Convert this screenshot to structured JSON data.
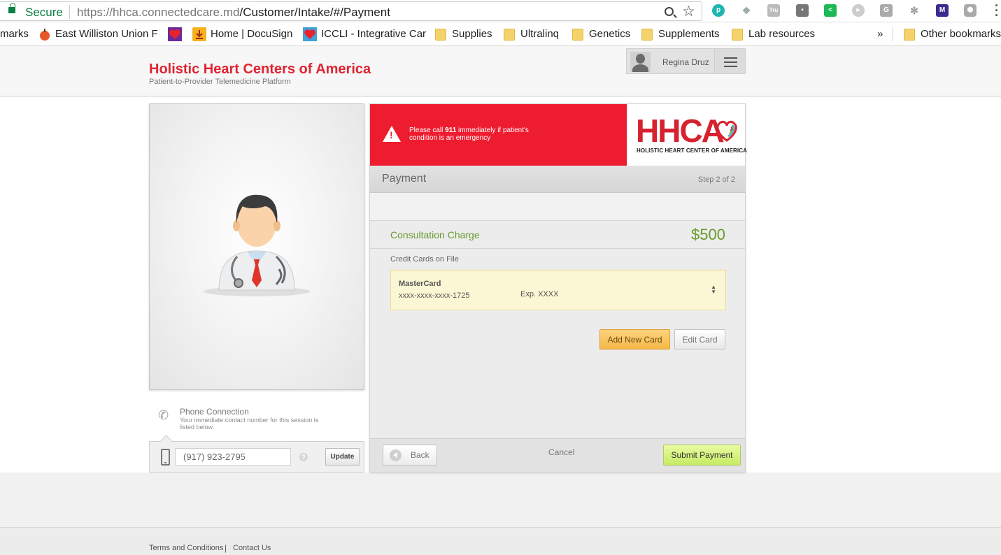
{
  "browser": {
    "secure_label": "Secure",
    "url_host": "https://hhca.connectedcare.md",
    "url_path": "/Customer/Intake/#/Payment",
    "ext_tru": "Tru",
    "ext_g": "G",
    "ext_m": "M",
    "bookmarks_cut": "marks",
    "bookmarks": [
      "East Williston Union F",
      "Home | DocuSign",
      "ICCLI - Integrative Car",
      "Supplies",
      "Ultralinq",
      "Genetics",
      "Supplements",
      "Lab resources"
    ],
    "more_bookmarks": "»",
    "other_bookmarks": "Other bookmarks"
  },
  "header": {
    "title": "Holistic Heart Centers of America",
    "subtitle": "Patient-to-Provider Telemedicine Platform",
    "user_name": "Regina Druz"
  },
  "phone": {
    "title": "Phone Connection",
    "description": "Your immediate contact number for this session is listed below.",
    "number": "(917) 923-2795",
    "help": "?",
    "update_label": "Update"
  },
  "alert": {
    "text_before": "Please call ",
    "emergency_number": "911",
    "text_after": " immediately if patient's condition is an emergency"
  },
  "logo": {
    "text": "HHCA",
    "subtitle": "HOLISTIC HEART CENTER OF AMERICA"
  },
  "payment": {
    "title": "Payment",
    "step": "Step 2 of 2",
    "charge_label": "Consultation Charge",
    "charge_amount": "$500",
    "cards_label": "Credit Cards on File",
    "card_brand": "MasterCard",
    "card_number": "xxxx-xxxx-xxxx-1725",
    "card_exp": "Exp. XXXX",
    "add_card_label": "Add New Card",
    "edit_card_label": "Edit Card",
    "back_label": "Back",
    "cancel_label": "Cancel",
    "submit_label": "Submit Payment"
  },
  "footer": {
    "terms": "Terms and Conditions",
    "separator": "|",
    "contact": "Contact Us"
  },
  "colors": {
    "brand_red": "#e02431",
    "alert_red": "#ee1c2f",
    "charge_green": "#6a9a2d",
    "submit_green": "#c6eb64",
    "add_card_orange": "#f5b848"
  }
}
